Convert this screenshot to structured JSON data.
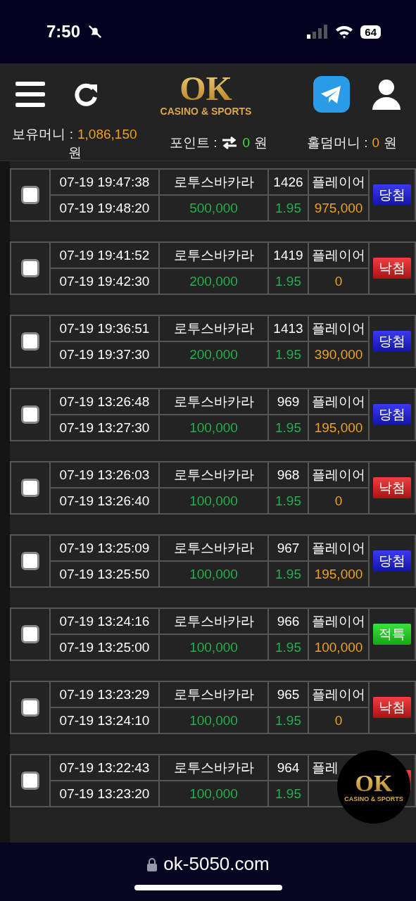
{
  "status_bar": {
    "time": "7:50",
    "battery": "64"
  },
  "header": {
    "logo": {
      "mark": "OK",
      "tagline": "CASINO & SPORTS"
    }
  },
  "balances": [
    {
      "kind": "money",
      "label": "보유머니 :",
      "value": "1,086,150",
      "unit": "원"
    },
    {
      "kind": "point",
      "label": "포인트 :",
      "value": "0",
      "unit": "원"
    },
    {
      "kind": "holdem",
      "label": "홀덤머니 :",
      "value": "0",
      "unit": "원"
    }
  ],
  "bets": [
    {
      "checked": false,
      "placed": "07-19 19:47:38",
      "settled": "07-19 19:48:20",
      "game": "로투스바카라",
      "round": "1426",
      "pick": "플레이어",
      "stake": "500,000",
      "odds": "1.95",
      "payout": "975,000",
      "status": {
        "kind": "win",
        "label": "당첨"
      }
    },
    {
      "checked": false,
      "placed": "07-19 19:41:52",
      "settled": "07-19 19:42:30",
      "game": "로투스바카라",
      "round": "1419",
      "pick": "플레이어",
      "stake": "200,000",
      "odds": "1.95",
      "payout": "0",
      "status": {
        "kind": "loss",
        "label": "낙첨"
      }
    },
    {
      "checked": false,
      "placed": "07-19 19:36:51",
      "settled": "07-19 19:37:30",
      "game": "로투스바카라",
      "round": "1413",
      "pick": "플레이어",
      "stake": "200,000",
      "odds": "1.95",
      "payout": "390,000",
      "status": {
        "kind": "win",
        "label": "당첨"
      }
    },
    {
      "checked": false,
      "placed": "07-19 13:26:48",
      "settled": "07-19 13:27:30",
      "game": "로투스바카라",
      "round": "969",
      "pick": "플레이어",
      "stake": "100,000",
      "odds": "1.95",
      "payout": "195,000",
      "status": {
        "kind": "win",
        "label": "당첨"
      }
    },
    {
      "checked": false,
      "placed": "07-19 13:26:03",
      "settled": "07-19 13:26:40",
      "game": "로투스바카라",
      "round": "968",
      "pick": "플레이어",
      "stake": "100,000",
      "odds": "1.95",
      "payout": "0",
      "status": {
        "kind": "loss",
        "label": "낙첨"
      }
    },
    {
      "checked": false,
      "placed": "07-19 13:25:09",
      "settled": "07-19 13:25:50",
      "game": "로투스바카라",
      "round": "967",
      "pick": "플레이어",
      "stake": "100,000",
      "odds": "1.95",
      "payout": "195,000",
      "status": {
        "kind": "win",
        "label": "당첨"
      }
    },
    {
      "checked": false,
      "placed": "07-19 13:24:16",
      "settled": "07-19 13:25:00",
      "game": "로투스바카라",
      "round": "966",
      "pick": "플레이어",
      "stake": "100,000",
      "odds": "1.95",
      "payout": "100,000",
      "status": {
        "kind": "void",
        "label": "적특"
      }
    },
    {
      "checked": false,
      "placed": "07-19 13:23:29",
      "settled": "07-19 13:24:10",
      "game": "로투스바카라",
      "round": "965",
      "pick": "플레이어",
      "stake": "100,000",
      "odds": "1.95",
      "payout": "0",
      "status": {
        "kind": "loss",
        "label": "낙첨"
      }
    },
    {
      "checked": false,
      "placed": "07-19 13:22:43",
      "settled": "07-19 13:23:20",
      "game": "로투스바카라",
      "round": "964",
      "pick": "플레",
      "stake": "100,000",
      "odds": "1.95",
      "status": {
        "kind": "loss"
      }
    }
  ],
  "floating_badge": {
    "mark": "OK",
    "tagline": "CASINO & SPORTS"
  },
  "address_bar": {
    "url": "ok-5050.com"
  }
}
